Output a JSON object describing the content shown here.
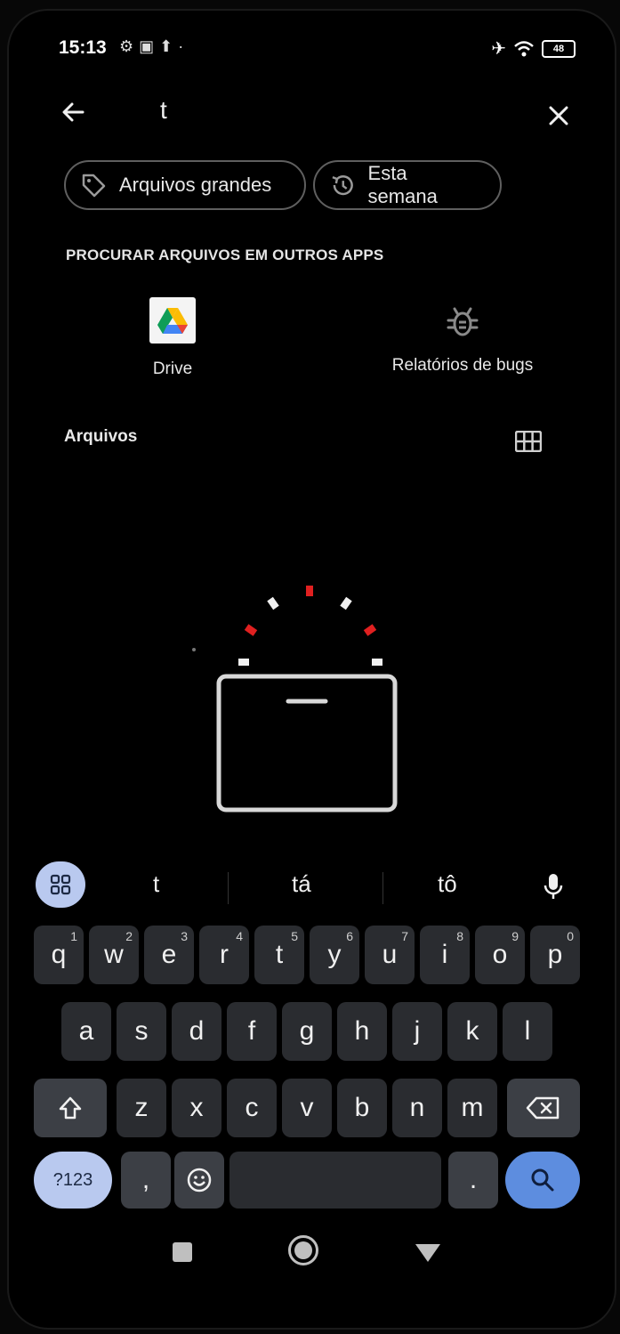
{
  "status_bar": {
    "time": "15:13",
    "battery": "48"
  },
  "search": {
    "query": "t",
    "back_icon": "arrow-left-icon",
    "close_icon": "close-icon"
  },
  "chips": [
    {
      "label": "Arquivos grandes",
      "icon": "tag-icon"
    },
    {
      "label": "Esta semana",
      "icon": "history-icon"
    }
  ],
  "other_apps": {
    "title": "PROCURAR ARQUIVOS EM OUTROS APPS",
    "apps": [
      {
        "label": "Drive",
        "icon": "google-drive-icon"
      },
      {
        "label": "Relatórios de bugs",
        "icon": "bug-icon"
      }
    ]
  },
  "files": {
    "label": "Arquivos",
    "view_icon": "grid-view-icon"
  },
  "suggestions": [
    "t",
    "tá",
    "tô"
  ],
  "keyboard": {
    "row1": [
      {
        "k": "q",
        "n": "1"
      },
      {
        "k": "w",
        "n": "2"
      },
      {
        "k": "e",
        "n": "3"
      },
      {
        "k": "r",
        "n": "4"
      },
      {
        "k": "t",
        "n": "5"
      },
      {
        "k": "y",
        "n": "6"
      },
      {
        "k": "u",
        "n": "7"
      },
      {
        "k": "i",
        "n": "8"
      },
      {
        "k": "o",
        "n": "9"
      },
      {
        "k": "p",
        "n": "0"
      }
    ],
    "row2": [
      "a",
      "s",
      "d",
      "f",
      "g",
      "h",
      "j",
      "k",
      "l"
    ],
    "row3": [
      "z",
      "x",
      "c",
      "v",
      "b",
      "n",
      "m"
    ],
    "symbols_label": "?123",
    "comma": ",",
    "period": "."
  },
  "colors": {
    "background": "#000000",
    "key": "#2a2c30",
    "accent_blue": "#5d8ddf",
    "pale_blue": "#b9c9ef"
  }
}
